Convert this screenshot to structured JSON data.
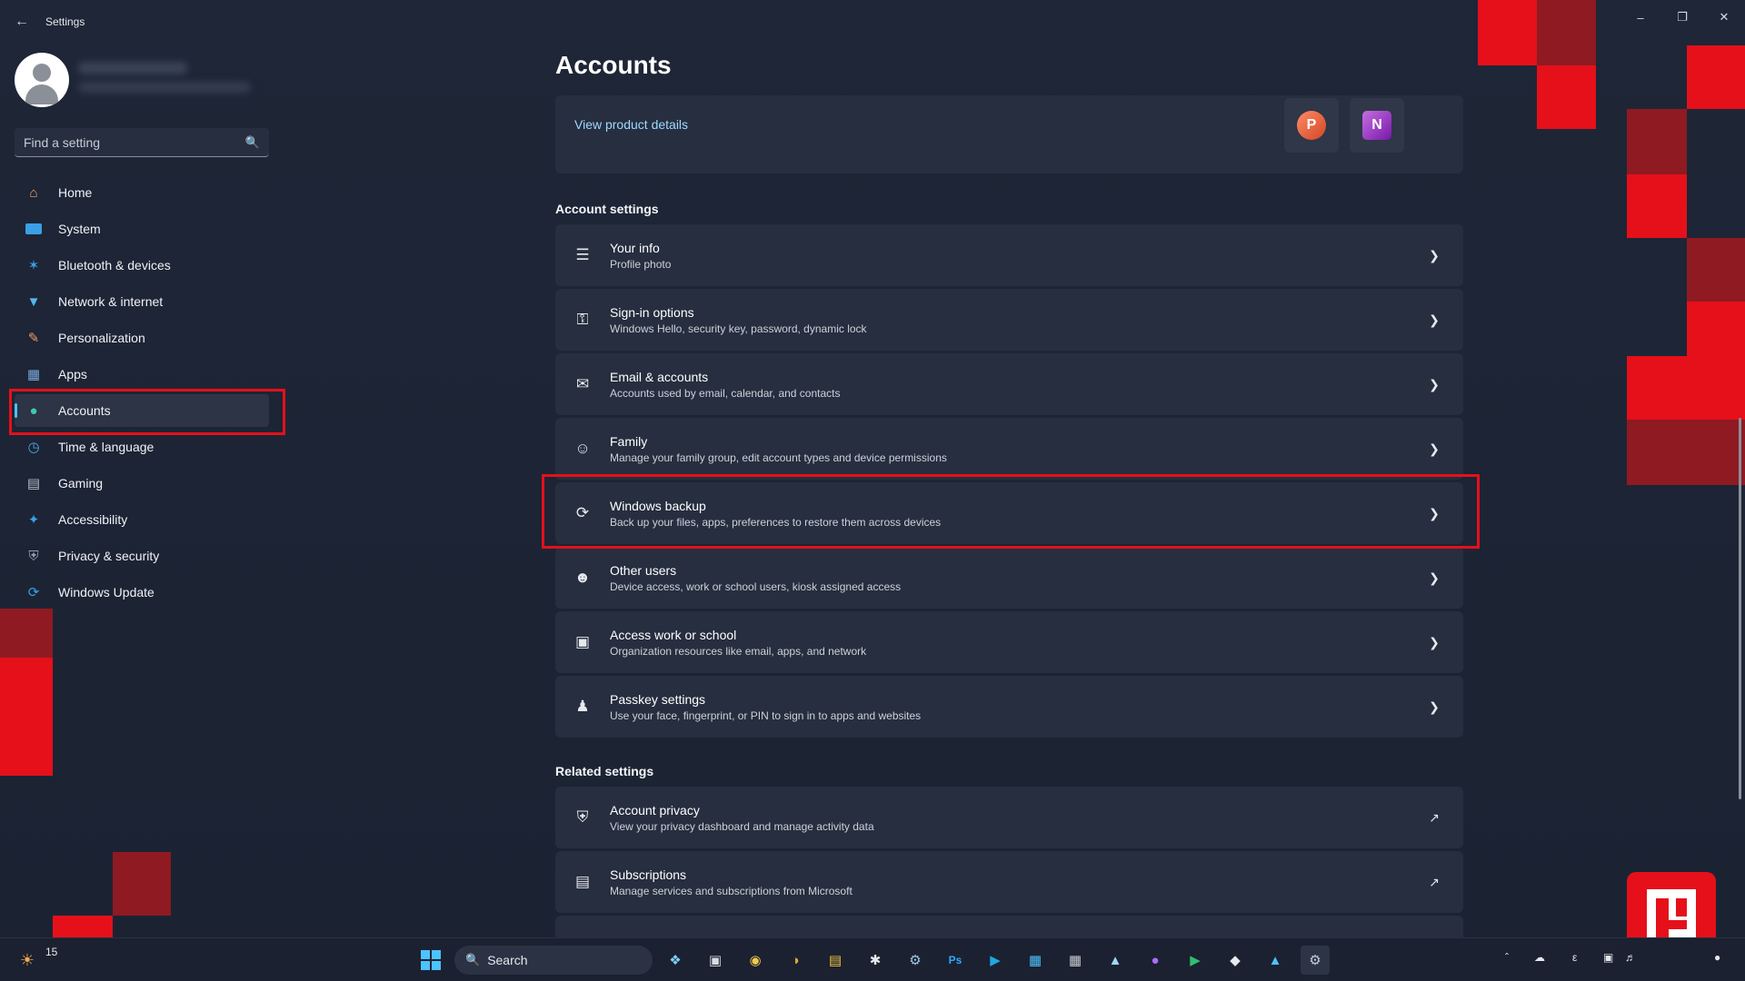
{
  "window": {
    "title": "Settings",
    "back_icon": "arrow-left-icon",
    "controls": [
      "minimize-icon",
      "maximize-icon",
      "close-icon"
    ]
  },
  "search": {
    "placeholder": "Find a setting"
  },
  "sidebar": {
    "items": [
      {
        "label": "Home",
        "icon": "home-icon"
      },
      {
        "label": "System",
        "icon": "monitor-icon"
      },
      {
        "label": "Bluetooth & devices",
        "icon": "bluetooth-icon"
      },
      {
        "label": "Network & internet",
        "icon": "wifi-icon"
      },
      {
        "label": "Personalization",
        "icon": "brush-icon"
      },
      {
        "label": "Apps",
        "icon": "apps-icon"
      },
      {
        "label": "Accounts",
        "icon": "person-icon",
        "active": true
      },
      {
        "label": "Time & language",
        "icon": "globe-clock-icon"
      },
      {
        "label": "Gaming",
        "icon": "gamepad-icon"
      },
      {
        "label": "Accessibility",
        "icon": "accessibility-icon"
      },
      {
        "label": "Privacy & security",
        "icon": "shield-icon"
      },
      {
        "label": "Windows Update",
        "icon": "update-icon"
      }
    ]
  },
  "main": {
    "title": "Accounts",
    "product_link": "View product details",
    "product_apps": [
      "P",
      "N"
    ],
    "account_settings_header": "Account settings",
    "account_settings": [
      {
        "title": "Your info",
        "subtitle": "Profile photo",
        "icon": "user-info-icon"
      },
      {
        "title": "Sign-in options",
        "subtitle": "Windows Hello, security key, password, dynamic lock",
        "icon": "key-icon"
      },
      {
        "title": "Email & accounts",
        "subtitle": "Accounts used by email, calendar, and contacts",
        "icon": "mail-icon"
      },
      {
        "title": "Family",
        "subtitle": "Manage your family group, edit account types and device permissions",
        "icon": "family-icon"
      },
      {
        "title": "Windows backup",
        "subtitle": "Back up your files, apps, preferences to restore them across devices",
        "icon": "sync-icon"
      },
      {
        "title": "Other users",
        "subtitle": "Device access, work or school users, kiosk assigned access",
        "icon": "add-user-icon"
      },
      {
        "title": "Access work or school",
        "subtitle": "Organization resources like email, apps, and network",
        "icon": "briefcase-icon"
      },
      {
        "title": "Passkey settings",
        "subtitle": "Use your face, fingerprint, or PIN to sign in to apps and websites",
        "icon": "passkey-icon"
      }
    ],
    "related_header": "Related settings",
    "related": [
      {
        "title": "Account privacy",
        "subtitle": "View your privacy dashboard and manage activity data",
        "icon": "shield-outline-icon"
      },
      {
        "title": "Subscriptions",
        "subtitle": "Manage services and subscriptions from Microsoft",
        "icon": "subscriptions-icon"
      }
    ]
  },
  "taskbar": {
    "search_label": "Search",
    "weather_temp": "15",
    "tray_text": "ε"
  },
  "colors": {
    "accent": "#4cc2ff",
    "highlight": "#e5101a",
    "card": "#262e3f",
    "link": "#9fd8ff"
  }
}
